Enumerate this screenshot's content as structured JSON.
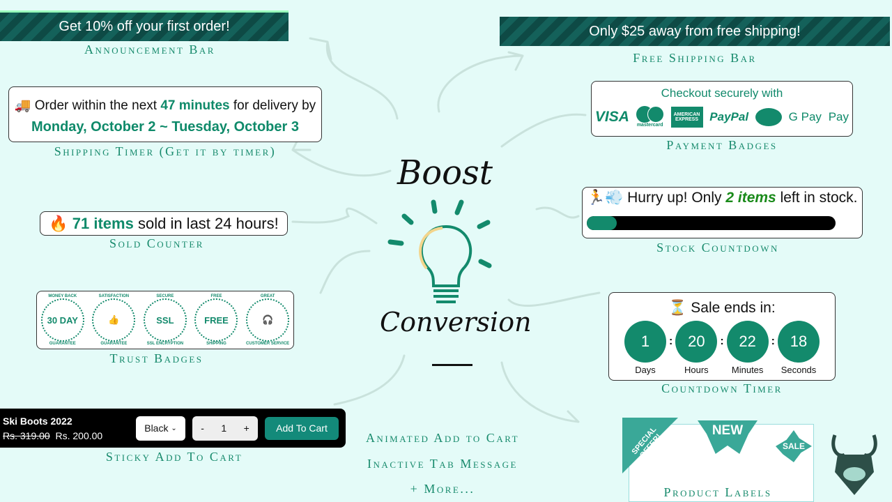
{
  "announcement": {
    "text": "Get 10% off your first order!",
    "label": "Announcement Bar"
  },
  "free_shipping": {
    "text": "Only $25 away from free shipping!",
    "label": "Free Shipping Bar"
  },
  "shipping_timer": {
    "icon": "🚚",
    "prefix": "Order within the next",
    "highlight": "47 minutes",
    "suffix": "for delivery by",
    "dates": "Monday, October 2 ~ Tuesday, October 3",
    "label": "Shipping Timer (Get it by timer)"
  },
  "payment": {
    "title": "Checkout securely with",
    "methods": [
      "VISA",
      "mastercard",
      "AMERICAN EXPRESS",
      "PayPal",
      "handshake",
      "G Pay",
      " Pay"
    ],
    "label": "Payment Badges"
  },
  "sold_counter": {
    "icon": "🔥",
    "highlight": "71 items",
    "text": "sold in last 24 hours!",
    "label": "Sold Counter"
  },
  "stock": {
    "icon": "🏃💨",
    "prefix": "Hurry up! Only",
    "highlight": "2 items",
    "suffix": "left in stock.",
    "progress_percent": 12,
    "label": "Stock Countdown"
  },
  "trust": {
    "badges": [
      {
        "top": "MONEY BACK",
        "center": "30 DAY",
        "bottom": "GUARANTEE"
      },
      {
        "top": "SATISFACTION",
        "center": "👍",
        "bottom": "GUARANTEE"
      },
      {
        "top": "SECURE",
        "center": "SSL",
        "bottom": "SSL ENCRYPTION"
      },
      {
        "top": "FREE",
        "center": "FREE",
        "bottom": "SHIPPING"
      },
      {
        "top": "GREAT",
        "center": "🎧",
        "bottom": "CUSTOMER SERVICE"
      }
    ],
    "label": "Trust Badges"
  },
  "countdown": {
    "title": "⏳ Sale ends in:",
    "units": [
      {
        "value": "1",
        "label": "Days"
      },
      {
        "value": "20",
        "label": "Hours"
      },
      {
        "value": "22",
        "label": "Minutes"
      },
      {
        "value": "18",
        "label": "Seconds"
      }
    ],
    "label": "Countdown Timer"
  },
  "sticky_cart": {
    "product": "Ski Boots 2022",
    "old_price": "Rs. 319.00",
    "price": "Rs. 200.00",
    "variant": "Black",
    "qty": "1",
    "minus": "-",
    "plus": "+",
    "button": "Add To Cart",
    "label": "Sticky Add To Cart"
  },
  "center": {
    "title1": "Boost",
    "title2": "Conversion"
  },
  "more": [
    "Animated Add to Cart",
    "Inactive Tab Message",
    "+ More..."
  ],
  "labels": {
    "special": "SPECIAL OFFER!",
    "new": "NEW",
    "sale": "SALE",
    "label": "Product Labels"
  },
  "colors": {
    "accent": "#138a6c",
    "background": "#e4fbf8",
    "bar": "#0e4a45"
  }
}
